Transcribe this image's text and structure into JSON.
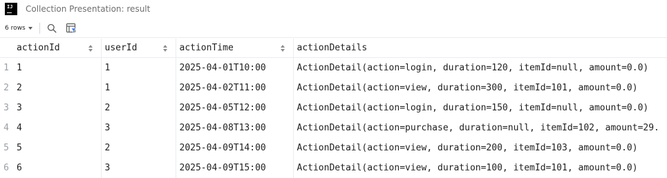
{
  "window": {
    "title": "Collection Presentation: result",
    "logo_text": "IJ"
  },
  "toolbar": {
    "rows_label": "6 rows",
    "icons": [
      "search-icon",
      "filter-icon"
    ]
  },
  "table": {
    "columns": [
      "actionId",
      "userId",
      "actionTime",
      "actionDetails"
    ],
    "rows": [
      {
        "num": "1",
        "cells": [
          "1",
          "1",
          "2025-04-01T10:00",
          "ActionDetail(action=login, duration=120, itemId=null, amount=0.0)"
        ]
      },
      {
        "num": "2",
        "cells": [
          "2",
          "1",
          "2025-04-02T11:00",
          "ActionDetail(action=view, duration=300, itemId=101, amount=0.0)"
        ]
      },
      {
        "num": "3",
        "cells": [
          "3",
          "2",
          "2025-04-05T12:00",
          "ActionDetail(action=login, duration=150, itemId=null, amount=0.0)"
        ]
      },
      {
        "num": "4",
        "cells": [
          "4",
          "3",
          "2025-04-08T13:00",
          "ActionDetail(action=purchase, duration=null, itemId=102, amount=29."
        ]
      },
      {
        "num": "5",
        "cells": [
          "5",
          "2",
          "2025-04-09T14:00",
          "ActionDetail(action=view, duration=200, itemId=103, amount=0.0)"
        ]
      },
      {
        "num": "6",
        "cells": [
          "6",
          "3",
          "2025-04-09T15:00",
          "ActionDetail(action=view, duration=100, itemId=101, amount=0.0)"
        ]
      }
    ]
  }
}
